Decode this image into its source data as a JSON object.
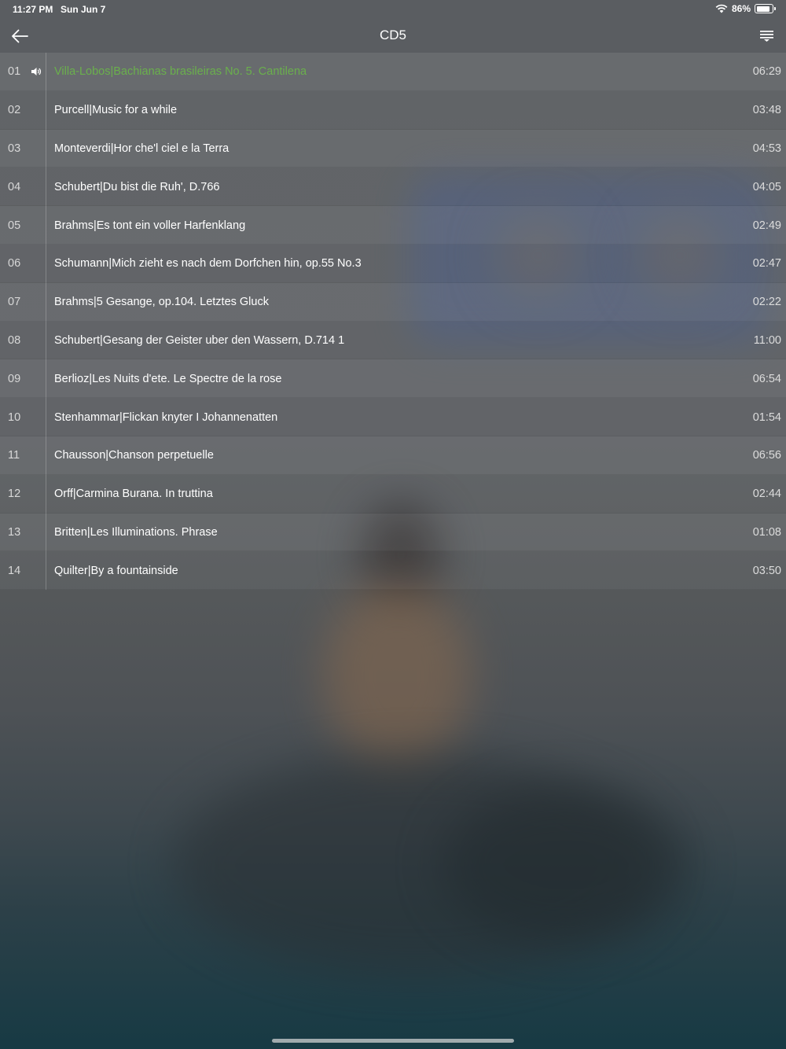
{
  "status_bar": {
    "time": "11:27 PM",
    "date": "Sun Jun 7",
    "battery": "86%",
    "battery_level": 0.86
  },
  "nav": {
    "title": "CD5",
    "back_icon": "arrow-left-icon",
    "menu_icon": "list-menu-icon"
  },
  "colors": {
    "playing": "#6ab04c"
  },
  "tracks": [
    {
      "num": "01",
      "title": "Villa-Lobos|Bachianas brasileiras No. 5. Cantilena",
      "duration": "06:29",
      "playing": true
    },
    {
      "num": "02",
      "title": "Purcell|Music for a while",
      "duration": "03:48"
    },
    {
      "num": "03",
      "title": "Monteverdi|Hor che'l ciel e la Terra",
      "duration": "04:53"
    },
    {
      "num": "04",
      "title": "Schubert|Du bist die Ruh', D.766",
      "duration": "04:05"
    },
    {
      "num": "05",
      "title": "Brahms|Es tont ein voller Harfenklang",
      "duration": "02:49"
    },
    {
      "num": "06",
      "title": "Schumann|Mich zieht es nach dem Dorfchen hin, op.55 No.3",
      "duration": "02:47"
    },
    {
      "num": "07",
      "title": "Brahms|5 Gesange, op.104. Letztes Gluck",
      "duration": "02:22"
    },
    {
      "num": "08",
      "title": "Schubert|Gesang der Geister uber den Wassern, D.714 1",
      "duration": "11:00"
    },
    {
      "num": "09",
      "title": "Berlioz|Les Nuits d'ete. Le Spectre de la rose",
      "duration": "06:54"
    },
    {
      "num": "10",
      "title": "Stenhammar|Flickan knyter I Johannenatten",
      "duration": "01:54"
    },
    {
      "num": "11",
      "title": "Chausson|Chanson perpetuelle",
      "duration": "06:56"
    },
    {
      "num": "12",
      "title": "Orff|Carmina Burana. In truttina",
      "duration": "02:44"
    },
    {
      "num": "13",
      "title": "Britten|Les Illuminations. Phrase",
      "duration": "01:08"
    },
    {
      "num": "14",
      "title": "Quilter|By a fountainside",
      "duration": "03:50"
    }
  ]
}
